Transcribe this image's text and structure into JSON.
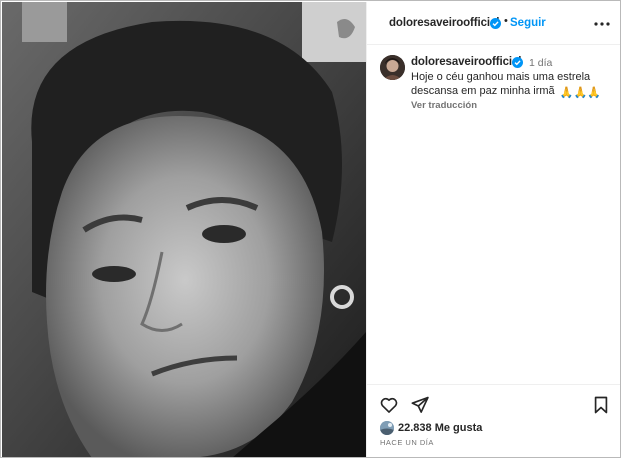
{
  "post": {
    "username": "doloresaveiroofficial",
    "follow_label": "Seguir",
    "separator": "•",
    "caption": {
      "username": "doloresaveiroofficial",
      "time_ago": "1 día",
      "lines": [
        "Hoje o céu ganhou mais uma estrela",
        "descansa em paz minha irmã"
      ],
      "emoji": "🙏🙏🙏",
      "translate_label": "Ver traducción"
    },
    "likes_text": "22.838 Me gusta",
    "date_text": "HACE UN DÍA"
  },
  "icons": {
    "verified": "verified-badge-icon",
    "more": "more-options-icon",
    "like": "heart-icon",
    "share": "share-icon",
    "save": "bookmark-icon"
  },
  "colors": {
    "accent": "#0095f6",
    "verified": "#0095f6",
    "text": "#262626",
    "secondary": "#737373"
  }
}
